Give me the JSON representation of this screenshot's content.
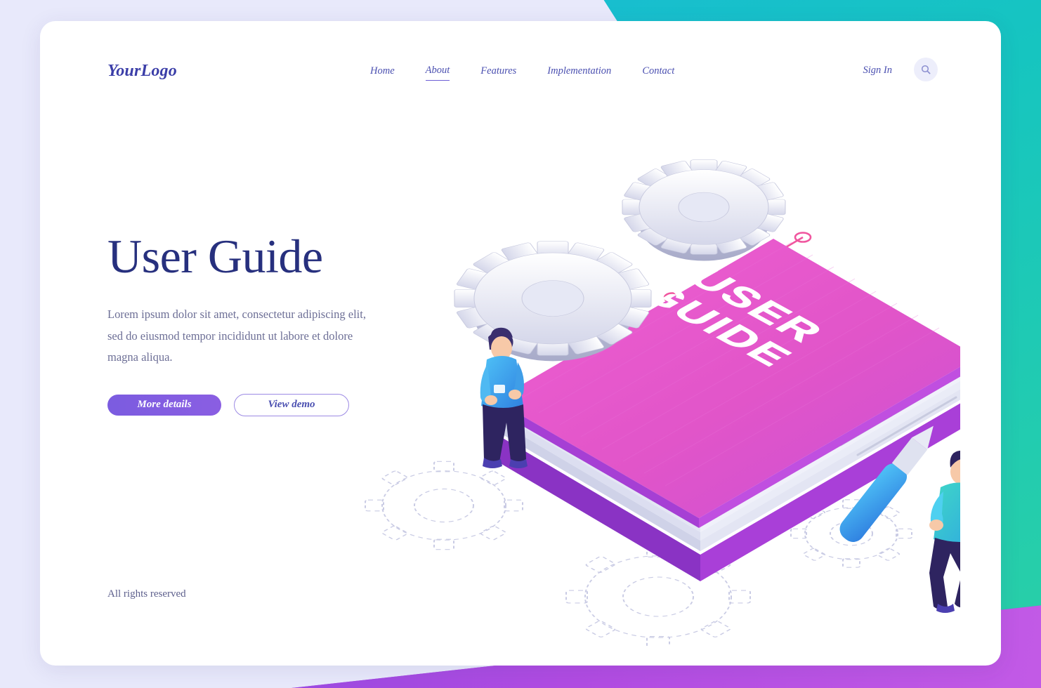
{
  "brand": {
    "logo_text": "YourLogo",
    "accent_color": "#7b5ce0",
    "heading_color": "#27307e"
  },
  "nav": {
    "items": [
      {
        "label": "Home",
        "active": false
      },
      {
        "label": "About",
        "active": true
      },
      {
        "label": "Features",
        "active": false
      },
      {
        "label": "Implementation",
        "active": false
      },
      {
        "label": "Contact",
        "active": false
      }
    ],
    "sign_in_label": "Sign In",
    "search_icon": "search-icon"
  },
  "hero": {
    "title": "User Guide",
    "body": "Lorem ipsum dolor sit amet, consectetur adipiscing elit, sed do eiusmod tempor incididunt ut labore et dolore magna aliqua.",
    "primary_button": "More details",
    "secondary_button": "View demo"
  },
  "footer": {
    "rights": "All rights reserved"
  },
  "illustration": {
    "book_cover_line1": "USER",
    "book_cover_line2": "GUIDE",
    "cover_color": "#e255c8",
    "spine_color": "#9a3fd0"
  }
}
